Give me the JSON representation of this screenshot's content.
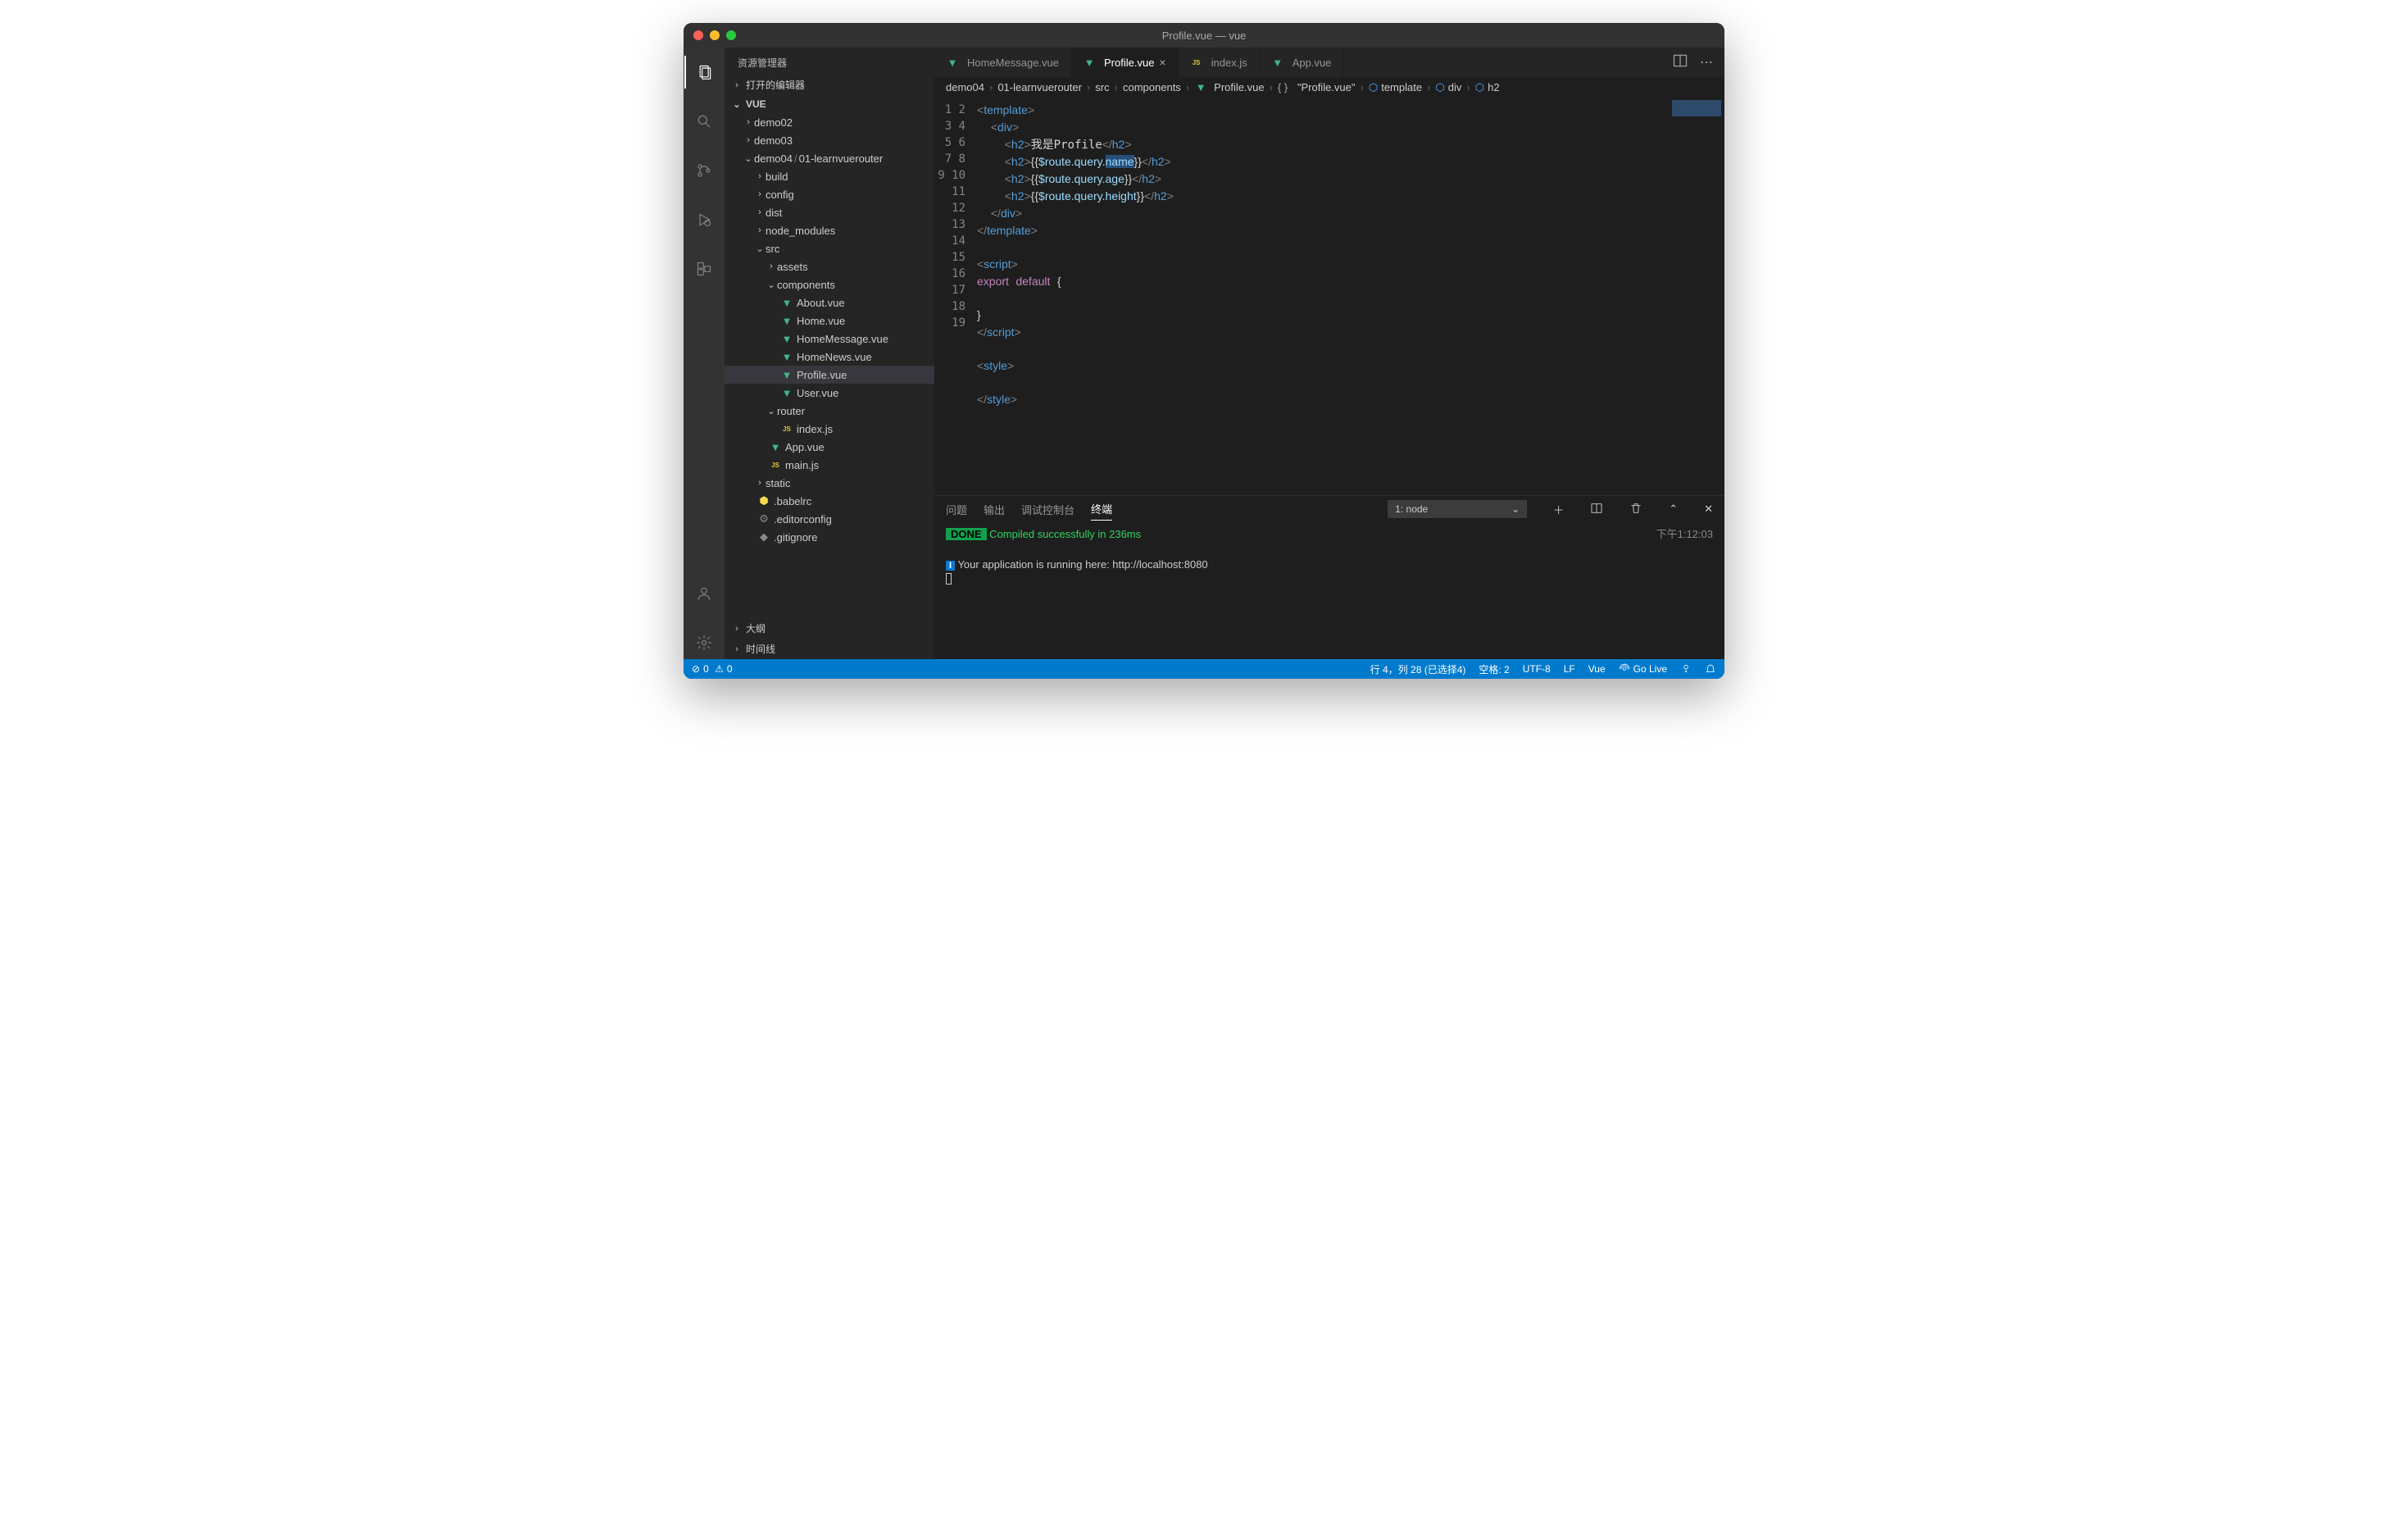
{
  "window": {
    "title": "Profile.vue — vue"
  },
  "sidebar": {
    "title": "资源管理器",
    "sections": {
      "open_editors": "打开的编辑器",
      "project": "VUE",
      "outline": "大纲",
      "timeline": "时间线"
    },
    "tree": {
      "demo02": "demo02",
      "demo03": "demo03",
      "demo04": "demo04",
      "demo04_sub": "01-learnvuerouter",
      "build": "build",
      "config": "config",
      "dist": "dist",
      "node_modules": "node_modules",
      "src": "src",
      "assets": "assets",
      "components": "components",
      "files": {
        "about": "About.vue",
        "home": "Home.vue",
        "homemsg": "HomeMessage.vue",
        "homenews": "HomeNews.vue",
        "profile": "Profile.vue",
        "user": "User.vue"
      },
      "router": "router",
      "index": "index.js",
      "app": "App.vue",
      "main": "main.js",
      "static": "static",
      "babelrc": ".babelrc",
      "editorconfig": ".editorconfig",
      "gitignore": ".gitignore"
    }
  },
  "tabs": [
    {
      "label": "HomeMessage.vue",
      "icon": "vue",
      "active": false
    },
    {
      "label": "Profile.vue",
      "icon": "vue",
      "active": true
    },
    {
      "label": "index.js",
      "icon": "js",
      "active": false
    },
    {
      "label": "App.vue",
      "icon": "vue",
      "active": false
    }
  ],
  "breadcrumbs": [
    "demo04",
    "01-learnvuerouter",
    "src",
    "components",
    "Profile.vue",
    "\"Profile.vue\"",
    "template",
    "div",
    "h2"
  ],
  "editor": {
    "lines_count": 19,
    "content_text": "我是Profile",
    "route_base": "$route.query",
    "fields": [
      "name",
      "age",
      "height"
    ],
    "selected_field": "name",
    "tags": {
      "template": "template",
      "div": "div",
      "h2": "h2",
      "script": "script",
      "style": "style"
    },
    "keywords": {
      "export": "export",
      "default": "default"
    }
  },
  "panel": {
    "tabs": [
      "问题",
      "输出",
      "调试控制台",
      "终端"
    ],
    "active_tab": 3,
    "terminal_select": "1: node",
    "done_label": "DONE",
    "compile_msg": " Compiled successfully in 236ms",
    "timestamp": "下午1:12:03",
    "info_badge": "I",
    "app_msg": " Your application is running here: http://localhost:8080"
  },
  "status": {
    "errors": "0",
    "warnings": "0",
    "cursor": "行 4，列 28 (已选择4)",
    "spaces": "空格: 2",
    "encoding": "UTF-8",
    "eol": "LF",
    "lang": "Vue",
    "golive": "Go Live"
  }
}
